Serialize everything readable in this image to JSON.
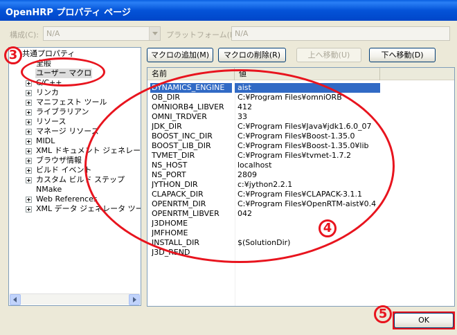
{
  "window": {
    "title": "OpenHRP プロパティ ページ"
  },
  "config": {
    "configuration_label": "構成(C):",
    "configuration_value": "N/A",
    "platform_label": "プラットフォーム(P):",
    "platform_value": "N/A"
  },
  "tree": {
    "root": "共通プロパティ",
    "items": [
      "全般",
      "ユーザー マクロ",
      "C/C++",
      "リンカ",
      "マニフェスト ツール",
      "ライブラリアン",
      "リソース",
      "マネージ リソース",
      "MIDL",
      "XML ドキュメント ジェネレータ",
      "ブラウザ情報",
      "ビルド イベント",
      "カスタム ビルド ステップ",
      "NMake",
      "Web References",
      "XML データ ジェネレータ ツール"
    ]
  },
  "toolbar": {
    "add_macro": "マクロの追加(M)",
    "delete_macro": "マクロの削除(R)",
    "move_up": "上へ移動(U)",
    "move_down": "下へ移動(D)"
  },
  "grid": {
    "headers": [
      "名前",
      "値"
    ],
    "rows": [
      [
        "DYNAMICS_ENGINE",
        "aist"
      ],
      [
        "OB_DIR",
        "C:¥Program Files¥omniORB"
      ],
      [
        "OMNIORB4_LIBVER",
        "412"
      ],
      [
        "OMNI_TRDVER",
        "33"
      ],
      [
        "JDK_DIR",
        "C:¥Program Files¥Java¥jdk1.6.0_07"
      ],
      [
        "BOOST_INC_DIR",
        "C:¥Program Files¥Boost-1.35.0"
      ],
      [
        "BOOST_LIB_DIR",
        "C:¥Program Files¥Boost-1.35.0¥lib"
      ],
      [
        "TVMET_DIR",
        "C:¥Program Files¥tvmet-1.7.2"
      ],
      [
        "NS_HOST",
        "localhost"
      ],
      [
        "NS_PORT",
        "2809"
      ],
      [
        "JYTHON_DIR",
        "c:¥jython2.2.1"
      ],
      [
        "CLAPACK_DIR",
        "C:¥Program Files¥CLAPACK-3.1.1"
      ],
      [
        "OPENRTM_DIR",
        "C:¥Program Files¥OpenRTM-aist¥0.4"
      ],
      [
        "OPENRTM_LIBVER",
        "042"
      ],
      [
        "J3DHOME",
        ""
      ],
      [
        "JMFHOME",
        ""
      ],
      [
        "INSTALL_DIR",
        "$(SolutionDir)"
      ],
      [
        "J3D_REND",
        ""
      ]
    ]
  },
  "annotations": {
    "three": "3",
    "four": "4",
    "five": "5"
  },
  "footer": {
    "ok": "OK"
  },
  "colors": {
    "accent_red": "#e8141e",
    "selection_blue": "#316ac5",
    "title_blue": "#0453d8"
  }
}
